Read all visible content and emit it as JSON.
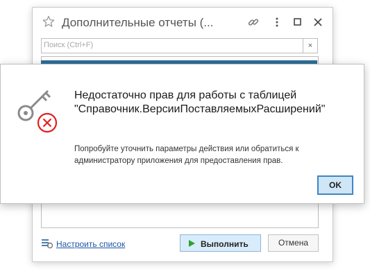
{
  "background_dialog": {
    "title": "Дополнительные отчеты (...",
    "search_placeholder": "Поиск (Ctrl+F)",
    "search_clear": "×",
    "configure_link": "Настроить список",
    "run_label": "Выполнить",
    "cancel_label": "Отмена"
  },
  "error_dialog": {
    "title": "Недостаточно прав для работы с таблицей \"Справочник.ВерсииПоставляемыхРасширений\"",
    "description": "Попробуйте уточнить параметры действия или обратиться к администратору приложения для предоставления прав.",
    "ok_label": "OK"
  },
  "icons": [
    "star-icon",
    "link-icon",
    "more-icon",
    "maximize-icon",
    "close-icon",
    "list-settings-icon",
    "play-icon",
    "key-icon",
    "error-icon"
  ],
  "colors": {
    "accent_blue": "#2f6f9a",
    "link_blue": "#1d56a5",
    "button_focus_border": "#3d86c4",
    "error_red": "#e02020",
    "run_green": "#2aa52a"
  }
}
